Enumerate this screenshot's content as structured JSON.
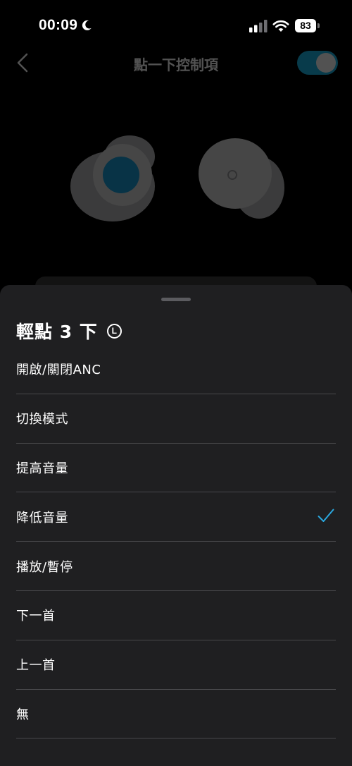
{
  "status_bar": {
    "time": "00:09",
    "battery": "83"
  },
  "background_page": {
    "title": "點一下控制項",
    "toggle_on": true
  },
  "sheet": {
    "title": "輕點 3 下",
    "badge": "L",
    "selected_index": 3,
    "accent_color": "#2aa8e0",
    "options": [
      {
        "label": "開啟/關閉ANC"
      },
      {
        "label": "切換模式"
      },
      {
        "label": "提高音量"
      },
      {
        "label": "降低音量",
        "selected": true
      },
      {
        "label": "播放/暫停"
      },
      {
        "label": "下一首"
      },
      {
        "label": "上一首"
      },
      {
        "label": "無"
      }
    ]
  },
  "icons": {
    "moon": "moon-icon",
    "signal": "cellular-signal-icon",
    "wifi": "wifi-icon",
    "battery": "battery-icon",
    "back": "chevron-left-icon",
    "check": "checkmark-icon"
  }
}
